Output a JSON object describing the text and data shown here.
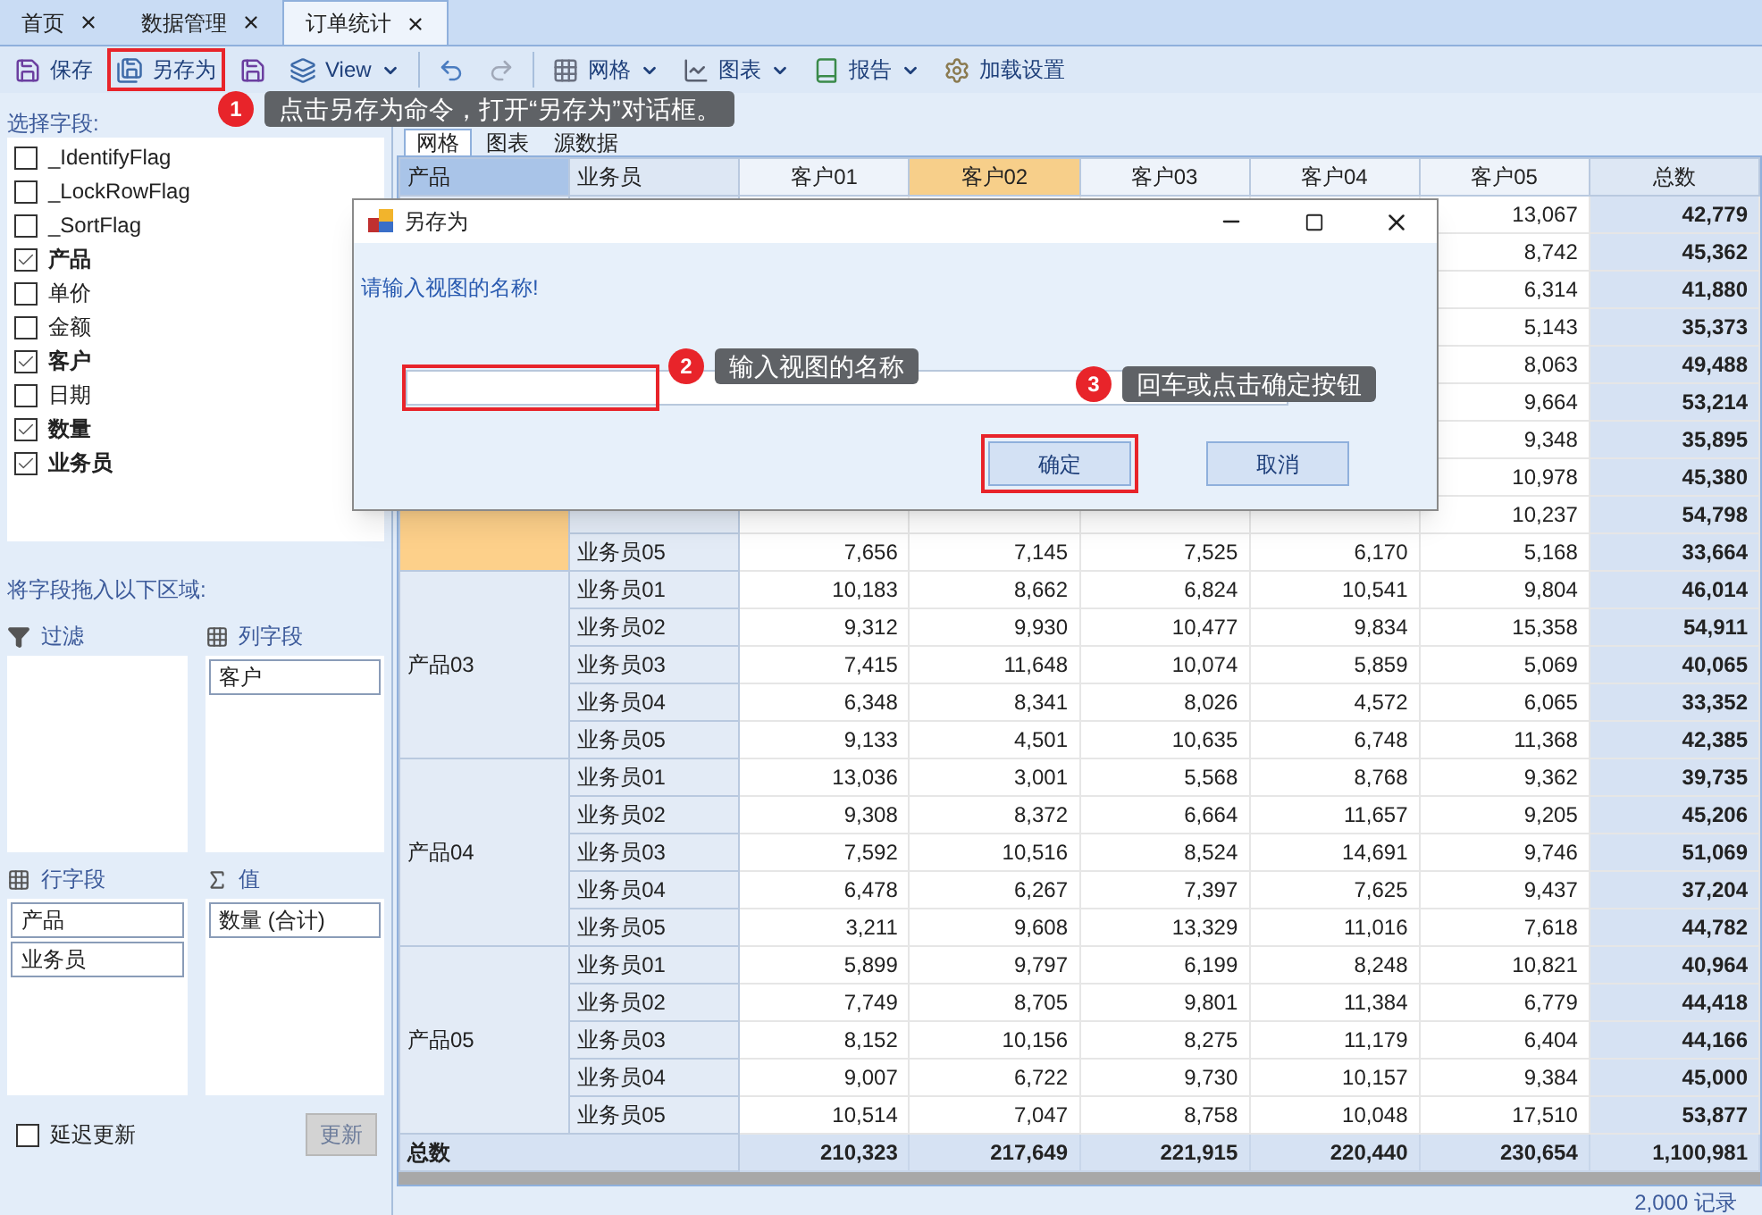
{
  "tabs": [
    {
      "label": "首页",
      "selected": false
    },
    {
      "label": "数据管理",
      "selected": false
    },
    {
      "label": "订单统计",
      "selected": true
    }
  ],
  "toolbar": [
    {
      "kind": "save",
      "label": "保存",
      "highlighted": false
    },
    {
      "kind": "save_as",
      "label": "另存为",
      "highlighted": true
    },
    {
      "kind": "save_icon",
      "highlighted": false
    },
    {
      "kind": "view",
      "label": "View",
      "highlighted": false
    },
    {
      "kind": "undo",
      "highlighted": false
    },
    {
      "kind": "redo",
      "highlighted": false
    },
    {
      "kind": "grid",
      "label": "网格",
      "highlighted": false
    },
    {
      "kind": "chart",
      "label": "图表",
      "highlighted": false
    },
    {
      "kind": "report",
      "label": "报告",
      "highlighted": false
    },
    {
      "kind": "settings",
      "label": "加载设置",
      "highlighted": false
    }
  ],
  "callouts": [
    {
      "number": "1",
      "text": "点击另存为命令，打开“另存为”对话框。"
    },
    {
      "number": "2",
      "text": "输入视图的名称"
    },
    {
      "number": "3",
      "text": "回车或点击确定按钮"
    }
  ],
  "field_list": {
    "title": "选择字段:",
    "fields": [
      {
        "label": "_IdentifyFlag",
        "checked": false
      },
      {
        "label": "_LockRowFlag",
        "checked": false
      },
      {
        "label": "_SortFlag",
        "checked": false
      },
      {
        "label": "产品",
        "checked": true
      },
      {
        "label": "单价",
        "checked": false
      },
      {
        "label": "金额",
        "checked": false
      },
      {
        "label": "客户",
        "checked": true
      },
      {
        "label": "日期",
        "checked": false
      },
      {
        "label": "数量",
        "checked": true
      },
      {
        "label": "业务员",
        "checked": true
      }
    ]
  },
  "drop_areas": {
    "title": "将字段拖入以下区域:",
    "zones": [
      {
        "kind": "filter",
        "label": "过滤"
      },
      {
        "kind": "columns",
        "label": "列字段",
        "items": [
          "客户"
        ]
      },
      {
        "kind": "rows",
        "label": "行字段",
        "items": [
          "产品",
          "业务员"
        ]
      },
      {
        "kind": "values",
        "label": "值",
        "items": [
          "数量 (合计)"
        ]
      }
    ]
  },
  "defer_update": {
    "label": "延迟更新",
    "checked": false
  },
  "update_button": {
    "label": "更新",
    "disabled": true
  },
  "view_tabs": [
    {
      "label": "网格",
      "selected": true
    },
    {
      "label": "图表",
      "selected": false
    },
    {
      "label": "源数据",
      "selected": false
    }
  ],
  "grid": {
    "columns": [
      {
        "label": "产品",
        "selected": false
      },
      {
        "label": "业务员",
        "selected": false
      },
      {
        "label": "客户01",
        "selected": false
      },
      {
        "label": "客户02",
        "selected": true
      },
      {
        "label": "客户03",
        "selected": false
      },
      {
        "label": "客户04",
        "selected": false
      },
      {
        "label": "客户05",
        "selected": false
      },
      {
        "label": "总数",
        "selected": false
      }
    ],
    "groups": [
      {
        "selected": false,
        "rows": [
          {
            "values": [
              "13,067",
              "42,779"
            ]
          },
          {
            "values": [
              "8,742",
              "45,362"
            ]
          },
          {
            "values": [
              "6,314",
              "41,880"
            ]
          },
          {
            "values": [
              "5,143",
              "35,373"
            ]
          },
          {
            "values": [
              "8,063",
              "49,488"
            ]
          }
        ]
      },
      {
        "selected": true,
        "rows": [
          {
            "values": [
              "9,664",
              "53,214"
            ]
          },
          {
            "values": [
              "9,348",
              "35,895"
            ]
          },
          {
            "values": [
              "10,978",
              "45,380"
            ]
          },
          {
            "values": [
              "10,237",
              "54,798"
            ]
          },
          {
            "salesperson": "业务员05",
            "values": [
              "7,656",
              "7,145",
              "7,525",
              "6,170",
              "5,168",
              "33,664"
            ]
          }
        ]
      },
      {
        "product": "产品03",
        "selected": false,
        "rows": [
          {
            "salesperson": "业务员01",
            "values": [
              "10,183",
              "8,662",
              "6,824",
              "10,541",
              "9,804",
              "46,014"
            ]
          },
          {
            "salesperson": "业务员02",
            "values": [
              "9,312",
              "9,930",
              "10,477",
              "9,834",
              "15,358",
              "54,911"
            ]
          },
          {
            "salesperson": "业务员03",
            "values": [
              "7,415",
              "11,648",
              "10,074",
              "5,859",
              "5,069",
              "40,065"
            ]
          },
          {
            "salesperson": "业务员04",
            "values": [
              "6,348",
              "8,341",
              "8,026",
              "4,572",
              "6,065",
              "33,352"
            ]
          },
          {
            "salesperson": "业务员05",
            "values": [
              "9,133",
              "4,501",
              "10,635",
              "6,748",
              "11,368",
              "42,385"
            ]
          }
        ]
      },
      {
        "product": "产品04",
        "selected": false,
        "rows": [
          {
            "salesperson": "业务员01",
            "values": [
              "13,036",
              "3,001",
              "5,568",
              "8,768",
              "9,362",
              "39,735"
            ]
          },
          {
            "salesperson": "业务员02",
            "values": [
              "9,308",
              "8,372",
              "6,664",
              "11,657",
              "9,205",
              "45,206"
            ]
          },
          {
            "salesperson": "业务员03",
            "values": [
              "7,592",
              "10,516",
              "8,524",
              "14,691",
              "9,746",
              "51,069"
            ]
          },
          {
            "salesperson": "业务员04",
            "values": [
              "6,478",
              "6,267",
              "7,397",
              "7,625",
              "9,437",
              "37,204"
            ]
          },
          {
            "salesperson": "业务员05",
            "values": [
              "3,211",
              "9,608",
              "13,329",
              "11,016",
              "7,618",
              "44,782"
            ]
          }
        ]
      },
      {
        "product": "产品05",
        "selected": false,
        "rows": [
          {
            "salesperson": "业务员01",
            "values": [
              "5,899",
              "9,797",
              "6,199",
              "8,248",
              "10,821",
              "40,964"
            ]
          },
          {
            "salesperson": "业务员02",
            "values": [
              "7,749",
              "8,705",
              "9,801",
              "11,384",
              "6,779",
              "44,418"
            ]
          },
          {
            "salesperson": "业务员03",
            "values": [
              "8,152",
              "10,156",
              "8,275",
              "11,179",
              "6,404",
              "44,166"
            ]
          },
          {
            "salesperson": "业务员04",
            "values": [
              "9,007",
              "6,722",
              "9,730",
              "10,157",
              "9,384",
              "45,000"
            ]
          },
          {
            "salesperson": "业务员05",
            "values": [
              "10,514",
              "7,047",
              "8,758",
              "10,048",
              "17,510",
              "53,877"
            ]
          }
        ]
      }
    ],
    "total": {
      "label": "总数",
      "values": [
        "210,323",
        "217,649",
        "221,915",
        "220,440",
        "230,654",
        "1,100,981"
      ]
    }
  },
  "status": "2,000 记录",
  "dialog": {
    "title": "另存为",
    "prompt": "请输入视图的名称!",
    "input": {
      "highlighted": true
    },
    "buttons": [
      {
        "label": "确定",
        "highlighted": true
      },
      {
        "label": "取消",
        "highlighted": false
      }
    ]
  }
}
